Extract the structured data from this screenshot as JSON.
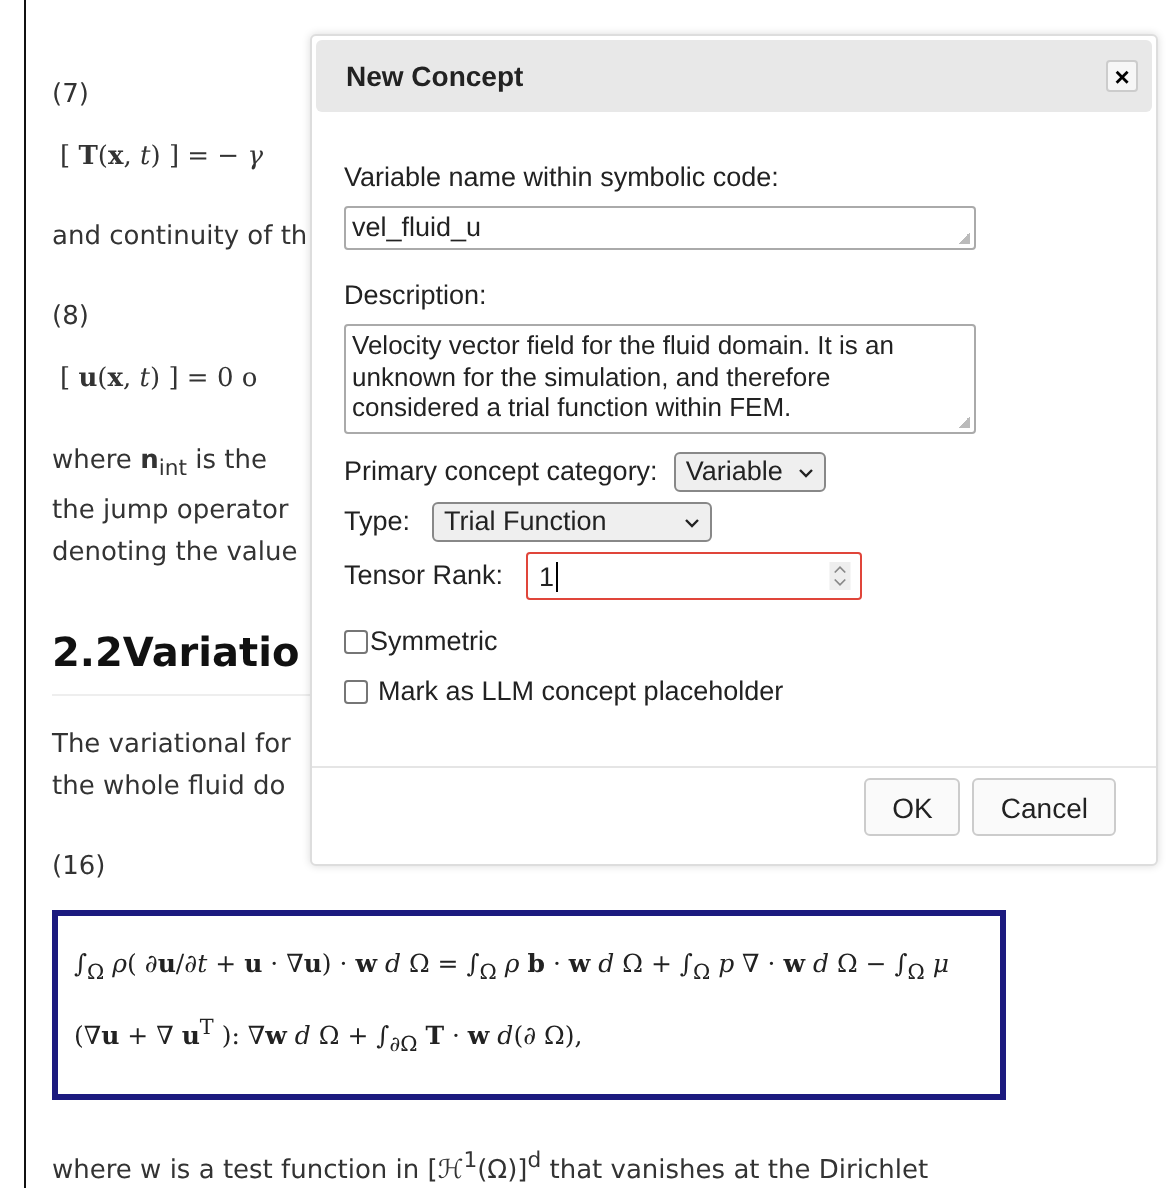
{
  "document": {
    "blocks": [
      {
        "kind": "eqnum",
        "text": "(7)"
      },
      {
        "kind": "math",
        "text": "[ **T**(**x**, *t*) ]  =  − *γ*"
      },
      {
        "kind": "para",
        "text": "and continuity of th"
      },
      {
        "kind": "eqnum",
        "text": "(8)"
      },
      {
        "kind": "math",
        "text": "[ **u**(**x**, *t*) ]  = 0   o"
      },
      {
        "kind": "line",
        "text": "where **n**$_{int}$ is the"
      },
      {
        "kind": "line",
        "text": "the jump operator"
      },
      {
        "kind": "line",
        "text": "denoting the value"
      },
      {
        "kind": "heading",
        "text": "2.2Variatio"
      },
      {
        "kind": "line",
        "text": "The variational for"
      },
      {
        "kind": "line",
        "text": "the whole fluid do"
      },
      {
        "kind": "eqnum",
        "text": "(16)"
      }
    ],
    "equation_box": {
      "lines": [
        "∫$_{Ω}$ *ρ*( ∂**u**/∂*t* + **u** · ∇**u**) · **w** *d* Ω =  ∫$_{Ω}$ *ρ* **b** · **w** *d* Ω +  ∫$_{Ω}$ *p* ∇ · **w** *d* Ω        −  ∫$_{Ω}$ *μ*",
        "(∇**u** + ∇ **u**$^{T}$ ): ∇**w** *d* Ω +  ∫$_{∂Ω}$ **T** · **w** *d*(∂ Ω),"
      ]
    },
    "footer_text": "where w is a test function in [ℋ$^{1}$(Ω)]$^{d}$ that vanishes at the Dirichlet"
  },
  "dialog": {
    "title": "New Concept",
    "close": "×",
    "name_label": "Variable name within symbolic code:",
    "name_value": "vel_fluid_u",
    "description_label": "Description:",
    "description_value": "Velocity vector field for the fluid domain. It is an unknown for the simulation, and therefore considered a trial function within FEM.",
    "category_label": "Primary concept category:",
    "category_value": "Variable",
    "type_label": "Type:",
    "type_value": "Trial Function",
    "rank_label": "Tensor Rank:",
    "rank_value": "1",
    "rank_focused": true,
    "checkboxes": [
      {
        "label": "Symmetric",
        "checked": false
      },
      {
        "label": "Mark as LLM concept placeholder",
        "checked": false
      }
    ],
    "buttons": [
      "OK",
      "Cancel"
    ]
  }
}
